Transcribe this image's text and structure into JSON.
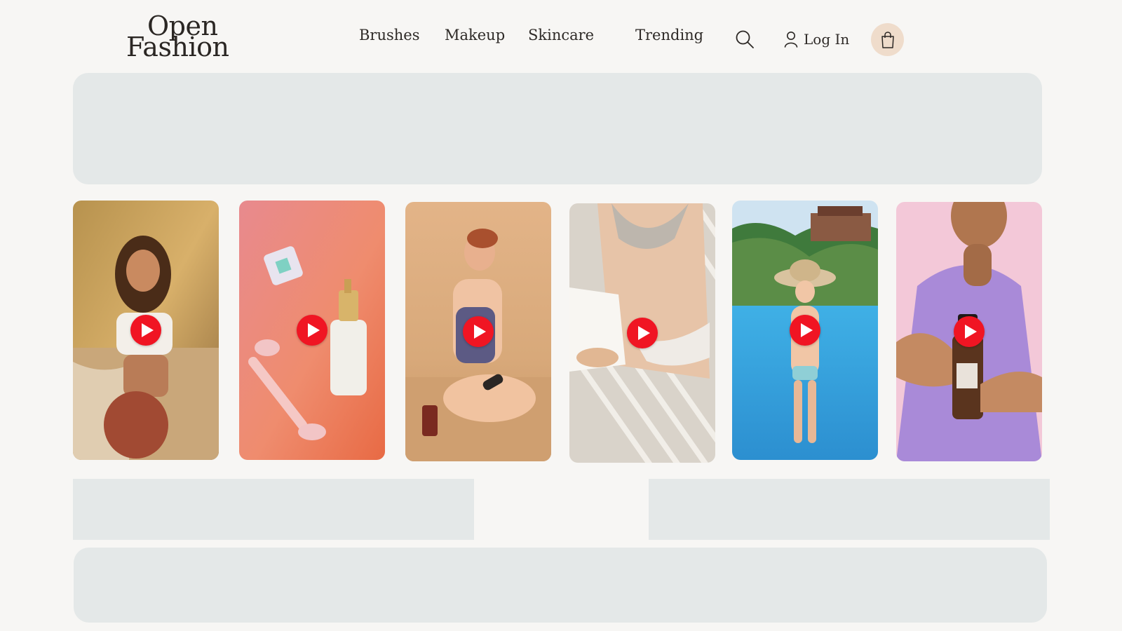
{
  "brand": {
    "logo_line1": "Open",
    "logo_line2": "Fashion"
  },
  "nav": {
    "items": [
      {
        "label": "Brushes"
      },
      {
        "label": "Makeup"
      },
      {
        "label": "Skincare"
      },
      {
        "label": "Trending"
      }
    ],
    "login_label": "Log In"
  },
  "icons": {
    "search": "search-icon",
    "user": "user-icon",
    "cart": "shopping-bag-icon",
    "play": "play-icon"
  },
  "colors": {
    "background": "#f7f6f4",
    "placeholder": "#e4e8e8",
    "cart_circle": "#efdccb",
    "play_button": "#f01523",
    "text": "#2e2a27"
  },
  "videos": [
    {
      "scene": "woman-beach-rocks"
    },
    {
      "scene": "skincare-bottle-face-roller"
    },
    {
      "scene": "woman-sand-bottle"
    },
    {
      "scene": "swimwear-towel"
    },
    {
      "scene": "woman-pool-hat"
    },
    {
      "scene": "hands-serum-bottle"
    }
  ]
}
